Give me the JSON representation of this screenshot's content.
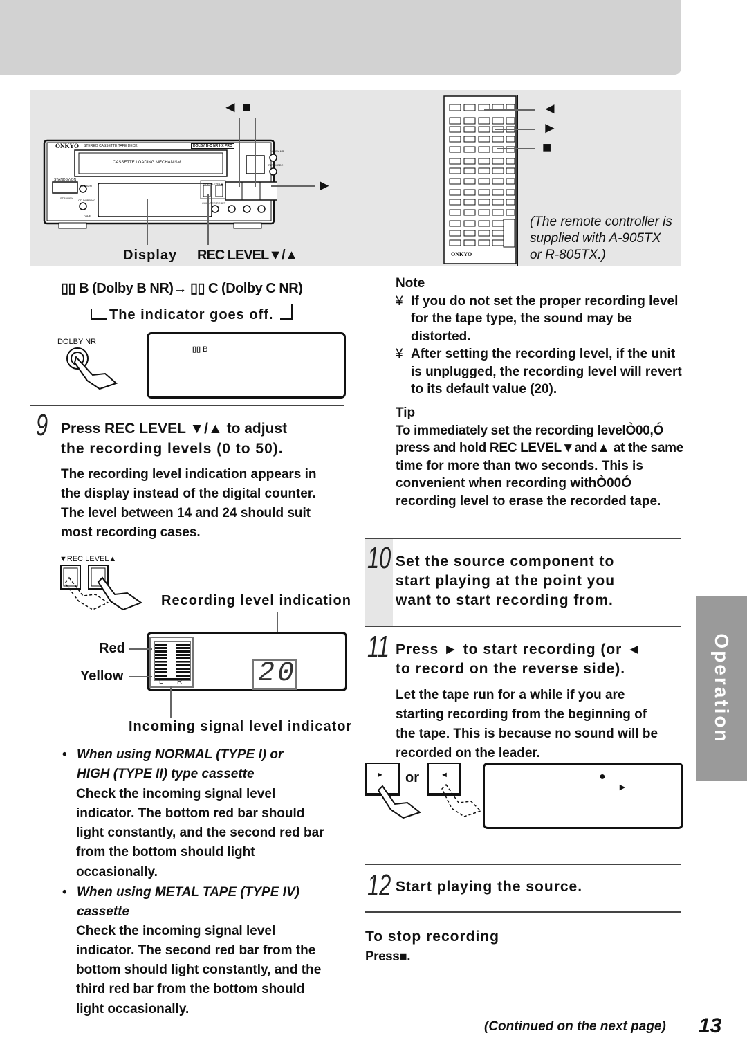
{
  "colors": {
    "banner": "#d2d2d2",
    "figure_bg": "#e6e6e6",
    "tab_bg": "#9a9a9a",
    "text": "#111111"
  },
  "figure": {
    "deck_brand": "ONKYO",
    "deck_model": "STEREO CASSETTE TAPE DECK",
    "deck_dolby_badge": "DOLBY B-C NR HX PRO",
    "deck_mechanism": "CASSETTE LOADING MECHANISM",
    "deck_small_labels": {
      "standby_on": "STANDBY/ON",
      "standby": "STANDBY",
      "album": "ALBUM",
      "cd_dubbing": "CD DUBBING",
      "fade": "FADE",
      "rec_level": "▼REC LEVEL▲",
      "counter_reset": "COUNTER RESET",
      "dolby_nr": "DOLBY NR",
      "rev_mode": "REV MODE"
    },
    "reverse_stop_label": "◄ ■",
    "play_label": "►",
    "display_label": "Display",
    "rec_level_label": "REC LEVEL▼/▲",
    "remote_labels": [
      "◄",
      "►",
      "■"
    ],
    "remote_brand": "ONKYO",
    "remote_caption": [
      "(The remote controller is",
      "supplied with A-905TX",
      "or R-805TX.)"
    ]
  },
  "dolby": {
    "line1_b": "B (Dolby B NR)",
    "line1_arrow": "→",
    "line1_c": "C (Dolby C NR)",
    "line2": "The indicator goes off.",
    "button_label": "DOLBY NR",
    "display_text": "B"
  },
  "step9": {
    "number": "9",
    "heading": [
      "Press REC LEVEL ▼/▲ to adjust",
      "the recording levels (0 to 50)."
    ],
    "body": [
      "The recording level indication appears in",
      "the display instead of the digital counter.",
      "The level between 14 and 24 should suit",
      "most recording cases."
    ],
    "rec_level_button_label": "▼REC LEVEL▲",
    "recording_level_indication": "Recording level indication",
    "red_label": "Red",
    "yellow_label": "Yellow",
    "meter_l": "L",
    "meter_r": "R",
    "level_value": "20",
    "incoming_label": "Incoming signal level indicator",
    "bullets": [
      {
        "title": [
          "When using NORMAL (TYPE I) or",
          "HIGH (TYPE II) type cassette"
        ],
        "text": [
          "Check the incoming signal level",
          "indicator. The bottom red bar should",
          "light constantly, and the second red bar",
          "from the bottom should light",
          "occasionally."
        ]
      },
      {
        "title": [
          "When using METAL TAPE (TYPE IV)",
          "cassette"
        ],
        "text": [
          "Check the incoming signal level",
          "indicator. The second red bar from the",
          "bottom should light constantly, and the",
          "third red bar from the bottom should",
          "light occasionally."
        ]
      }
    ]
  },
  "note": {
    "title": "Note",
    "bullet": "¥",
    "items": [
      [
        "If you do not set the proper recording level",
        "for the tape type, the sound may be",
        "distorted."
      ],
      [
        "After setting the recording level, if the unit",
        "is unplugged, the recording level will revert",
        "to its default value (20)."
      ]
    ]
  },
  "tip": {
    "title": "Tip",
    "lines": [
      "To immediately set the recording levelÒ00,Ó",
      "press and hold REC LEVEL▼and▲ at the same",
      "time for more than two seconds. This is",
      "convenient when recording withÒ00Ó",
      "recording level to erase the recorded tape."
    ]
  },
  "step10": {
    "number": "10",
    "heading": [
      "Set the source component to",
      "start playing at the point you",
      "want to start recording from."
    ]
  },
  "step11": {
    "number": "11",
    "heading": [
      "Press ► to start recording (or ◄",
      "to record on the reverse side)."
    ],
    "body": [
      "Let the tape run for a while if you are",
      "starting recording from the beginning of",
      "the tape. This is because no sound will be",
      "recorded on the leader."
    ],
    "or": "or",
    "play_glyph": "►",
    "rev_glyph": "◄",
    "display_rec": "●",
    "display_play": "►"
  },
  "step12": {
    "number": "12",
    "heading": "Start playing the source."
  },
  "stop": {
    "title": "To stop recording",
    "text": "Press■."
  },
  "side_tab": "Operation",
  "footer": {
    "continued": "(Continued on the next page)",
    "page_number": "13"
  }
}
